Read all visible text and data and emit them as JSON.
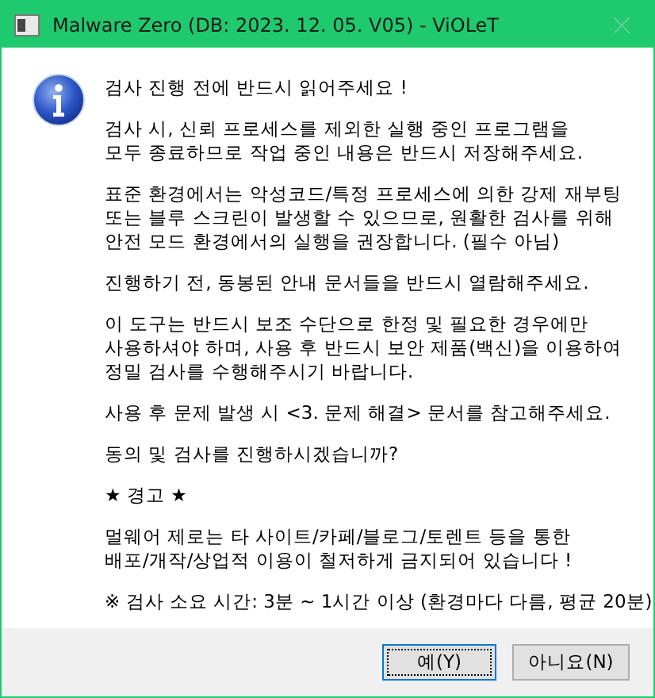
{
  "window": {
    "title": "Malware Zero (DB: 2023. 12. 05. V05) - ViOLeT"
  },
  "message": {
    "paragraphs": [
      {
        "lines": [
          "검사 진행 전에 반드시 읽어주세요 !"
        ]
      },
      {
        "lines": [
          "검사 시, 신뢰 프로세스를 제외한 실행 중인 프로그램을",
          "모두 종료하므로 작업 중인 내용은 반드시 저장해주세요."
        ]
      },
      {
        "lines": [
          "표준 환경에서는 악성코드/특정 프로세스에 의한 강제 재부팅",
          "또는 블루 스크린이 발생할 수 있으므로, 원활한 검사를 위해",
          "안전 모드 환경에서의 실행을 권장합니다. (필수 아님)"
        ]
      },
      {
        "lines": [
          "진행하기 전, 동봉된 안내 문서들을 반드시 열람해주세요."
        ]
      },
      {
        "lines": [
          "이 도구는 반드시 보조 수단으로 한정 및 필요한 경우에만",
          "사용하셔야 하며, 사용 후 반드시 보안 제품(백신)을 이용하여",
          "정밀 검사를 수행해주시기 바랍니다."
        ]
      },
      {
        "lines": [
          "사용 후 문제 발생 시 <3. 문제 해결> 문서를 참고해주세요."
        ]
      },
      {
        "lines": [
          "동의 및 검사를 진행하시겠습니까?"
        ]
      },
      {
        "lines": [
          "★ 경고 ★"
        ]
      },
      {
        "lines": [
          "멀웨어 제로는 타 사이트/카페/블로그/토렌트 등을 통한",
          "배포/개작/상업적 이용이 철저하게 금지되어 있습니다 !"
        ]
      },
      {
        "lines": [
          "※ 검사 소요 시간: 3분 ~ 1시간 이상 (환경마다 다름, 평균 20분)"
        ]
      }
    ]
  },
  "buttons": [
    {
      "label": "예(Y)",
      "selected": true
    },
    {
      "label": "아니요(N)",
      "selected": false
    }
  ]
}
